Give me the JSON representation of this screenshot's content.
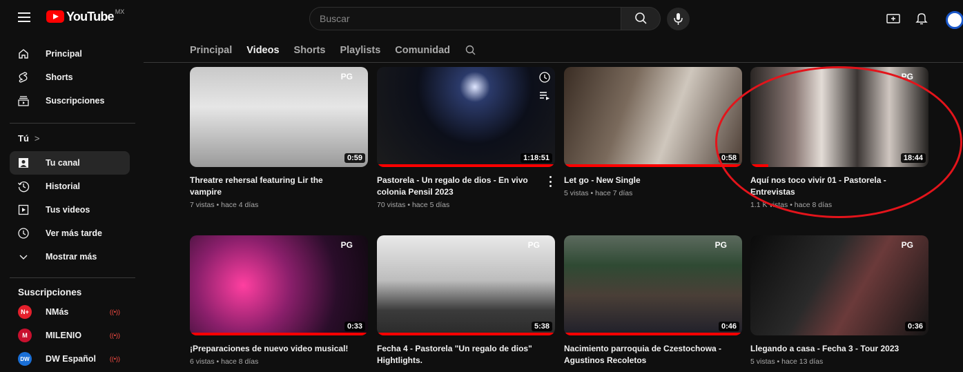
{
  "topbar": {
    "logo_text": "YouTube",
    "country": "MX",
    "search_placeholder": "Buscar"
  },
  "sidebar": {
    "main": [
      {
        "label": "Principal",
        "icon": "home-icon"
      },
      {
        "label": "Shorts",
        "icon": "shorts-icon"
      },
      {
        "label": "Suscripciones",
        "icon": "subscriptions-icon"
      }
    ],
    "you_header": "Tú",
    "you_chevron": ">",
    "you": [
      {
        "label": "Tu canal",
        "icon": "your-channel-icon",
        "active": true
      },
      {
        "label": "Historial",
        "icon": "history-icon"
      },
      {
        "label": "Tus videos",
        "icon": "your-videos-icon"
      },
      {
        "label": "Ver más tarde",
        "icon": "watch-later-icon"
      },
      {
        "label": "Mostrar más",
        "icon": "chevron-down-icon"
      }
    ],
    "subs_header": "Suscripciones",
    "subs": [
      {
        "label": "NMás",
        "avatar_text": "N+",
        "color": "#e4202c",
        "live": "((•))"
      },
      {
        "label": "MILENIO",
        "avatar_text": "M",
        "color": "#c8102e",
        "live": "((•))"
      },
      {
        "label": "DW Español",
        "avatar_text": "DW",
        "color": "#1a6fd6",
        "live": "((•))"
      }
    ]
  },
  "tabs": [
    "Principal",
    "Videos",
    "Shorts",
    "Playlists",
    "Comunidad"
  ],
  "active_tab": "Videos",
  "videos": [
    {
      "title": "Threatre rehersal featuring Lir the vampire",
      "meta": "7 vistas • hace 4 días",
      "duration": "0:59",
      "progress": 0,
      "rating": "PG"
    },
    {
      "title": "Pastorela - Un regalo de dios - En vivo colonia Pensil 2023",
      "meta": "70 vistas • hace 5 días",
      "duration": "1:18:51",
      "progress": 1.0,
      "rating": ""
    },
    {
      "title": "Let go - New Single",
      "meta": "5 vistas • hace 7 días",
      "duration": "0:58",
      "progress": 1.0,
      "rating": ""
    },
    {
      "title": "Aquí nos toco vivir 01 - Pastorela - Entrevistas",
      "meta": "1.1 K vistas • hace 8 días",
      "duration": "18:44",
      "progress": 0.1,
      "rating": "PG"
    },
    {
      "title": "¡Preparaciones de nuevo video musical!",
      "meta": "6 vistas • hace 8 días",
      "duration": "0:33",
      "progress": 1.0,
      "rating": "PG"
    },
    {
      "title": "Fecha 4 - Pastorela \"Un regalo de dios\" Hightlights.",
      "meta": "",
      "duration": "5:38",
      "progress": 1.0,
      "rating": "PG"
    },
    {
      "title": "Nacimiento parroquia de Czestochowa - Agustinos Recoletos",
      "meta": "",
      "duration": "0:46",
      "progress": 1.0,
      "rating": "PG"
    },
    {
      "title": "Llegando a casa - Fecha 3 - Tour 2023",
      "meta": "5 vistas • hace 13 días",
      "duration": "0:36",
      "progress": 0,
      "rating": "PG"
    }
  ],
  "colors": {
    "background": "#0f0f0f",
    "accent": "#ff0000",
    "annotation": "#e3141b"
  }
}
